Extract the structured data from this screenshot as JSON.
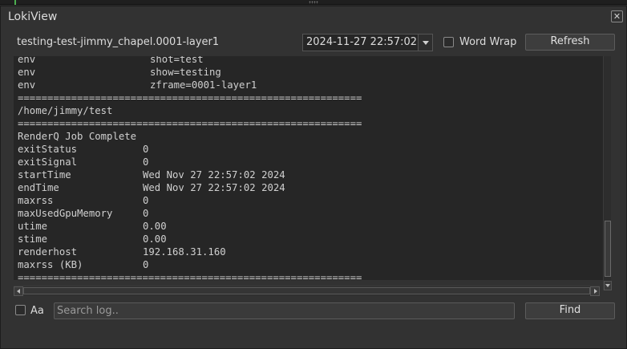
{
  "window": {
    "title": "LokiView",
    "close_glyph": "✕"
  },
  "header": {
    "job_name": "testing-test-jimmy_chapel.0001-layer1",
    "date_value": "2024-11-27 22:57:02",
    "word_wrap_label": "Word Wrap",
    "word_wrap_checked": false,
    "refresh_label": "Refresh"
  },
  "log": {
    "lines": [
      [
        "env",
        "shot=test"
      ],
      [
        "env",
        "show=testing"
      ],
      [
        "env",
        "zframe=0001-layer1"
      ],
      [
        "==========================================================",
        ""
      ],
      [
        "/home/jimmy/test",
        ""
      ],
      [
        "==========================================================",
        ""
      ],
      [
        "RenderQ Job Complete",
        ""
      ],
      [
        "exitStatus",
        "0"
      ],
      [
        "exitSignal",
        "0"
      ],
      [
        "startTime",
        "Wed Nov 27 22:57:02 2024"
      ],
      [
        "endTime",
        "Wed Nov 27 22:57:02 2024"
      ],
      [
        "maxrss",
        "0"
      ],
      [
        "maxUsedGpuMemory",
        "0"
      ],
      [
        "utime",
        "0.00"
      ],
      [
        "stime",
        "0.00"
      ],
      [
        "renderhost",
        "192.168.31.160"
      ],
      [
        "maxrss (KB)",
        "0"
      ],
      [
        "==========================================================",
        ""
      ]
    ]
  },
  "footer": {
    "case_label": "Aa",
    "case_checked": false,
    "search_placeholder": "Search log..",
    "search_value": "",
    "find_label": "Find"
  },
  "colors": {
    "background": "#323232",
    "log_bg": "#262626",
    "text": "#d0d0d0",
    "accent": "#4caf50"
  }
}
